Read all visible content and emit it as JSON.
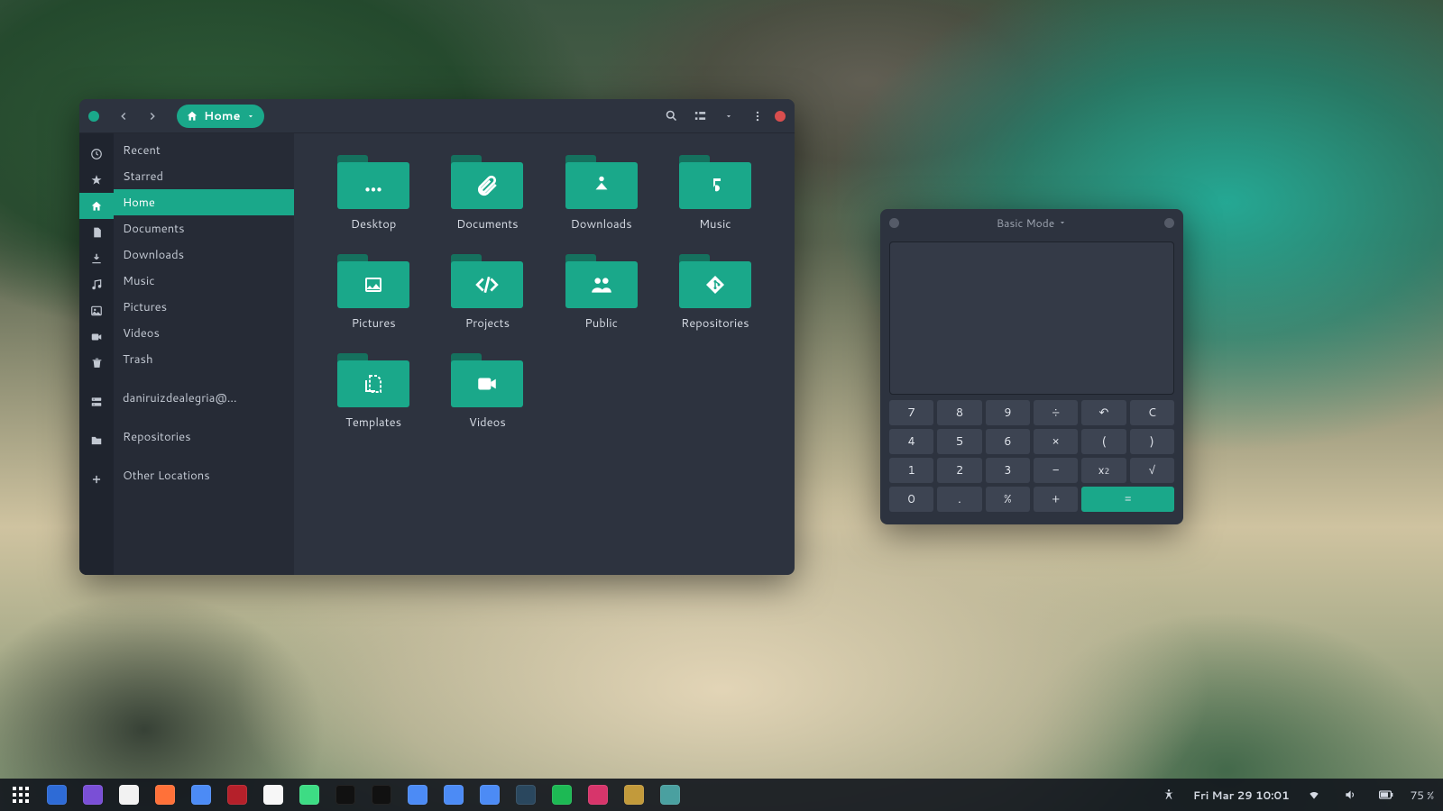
{
  "file_manager": {
    "path_label": "Home",
    "sidebar": [
      {
        "icon": "clock",
        "label": "Recent"
      },
      {
        "icon": "star",
        "label": "Starred"
      },
      {
        "icon": "home",
        "label": "Home",
        "active": true
      },
      {
        "icon": "doc",
        "label": "Documents"
      },
      {
        "icon": "download",
        "label": "Downloads"
      },
      {
        "icon": "music",
        "label": "Music"
      },
      {
        "icon": "image",
        "label": "Pictures"
      },
      {
        "icon": "video",
        "label": "Videos"
      },
      {
        "icon": "trash",
        "label": "Trash"
      },
      {
        "icon": "sep"
      },
      {
        "icon": "server",
        "label": "daniruizdealegria@…"
      },
      {
        "icon": "sep"
      },
      {
        "icon": "folder",
        "label": "Repositories"
      },
      {
        "icon": "sep"
      },
      {
        "icon": "plus",
        "label": "Other Locations"
      }
    ],
    "folders": [
      {
        "name": "Desktop",
        "glyph": "dots"
      },
      {
        "name": "Documents",
        "glyph": "clip"
      },
      {
        "name": "Downloads",
        "glyph": "dl"
      },
      {
        "name": "Music",
        "glyph": "note"
      },
      {
        "name": "Pictures",
        "glyph": "img"
      },
      {
        "name": "Projects",
        "glyph": "code"
      },
      {
        "name": "Public",
        "glyph": "people"
      },
      {
        "name": "Repositories",
        "glyph": "git"
      },
      {
        "name": "Templates",
        "glyph": "tpl"
      },
      {
        "name": "Videos",
        "glyph": "vid"
      }
    ]
  },
  "calculator": {
    "mode_label": "Basic Mode",
    "keys": [
      [
        "7",
        "8",
        "9",
        "÷",
        "↶",
        "C"
      ],
      [
        "4",
        "5",
        "6",
        "×",
        "(",
        ")"
      ],
      [
        "1",
        "2",
        "3",
        "−",
        "x²",
        "√"
      ],
      [
        "0",
        ".",
        "%",
        "+",
        "=",
        "="
      ]
    ]
  },
  "taskbar": {
    "datetime": "Fri Mar 29  10:01",
    "battery": "75 %",
    "apps": [
      "apps",
      "blueman",
      "pidgin",
      "mail",
      "firefox",
      "chromium",
      "filezilla",
      "gedit",
      "android-studio",
      "webstorm",
      "intellij",
      "files",
      "software",
      "settings",
      "steam",
      "spotify",
      "lollypop",
      "tilix",
      "calculator"
    ]
  },
  "colors": {
    "accent": "#1aa88a",
    "window": "#2d333f",
    "sidebar": "#262b36"
  }
}
